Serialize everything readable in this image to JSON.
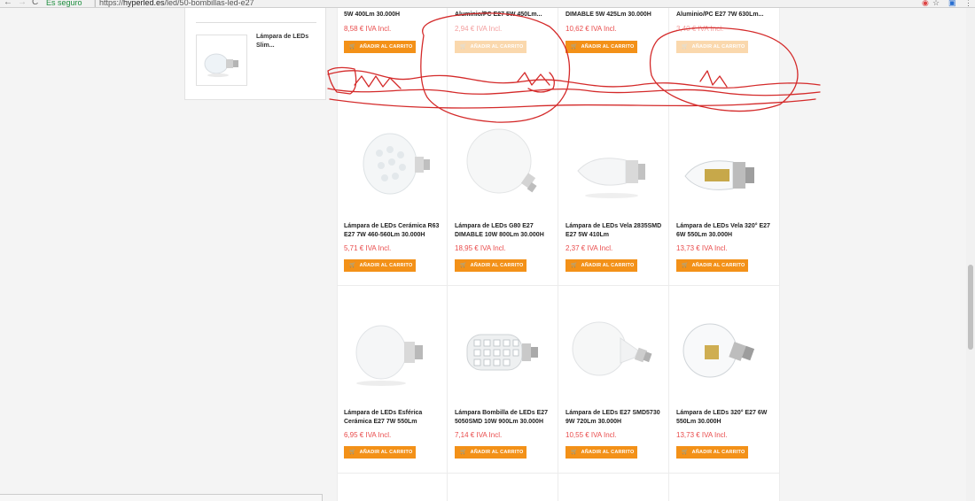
{
  "browser": {
    "nav_back": "←",
    "nav_forward": "→",
    "nav_reload": "C",
    "secure_label": "Es seguro",
    "separator": "|",
    "url_prefix": "https://",
    "url_domain": "hyperled.es",
    "url_path": "/led/50-bombillas-led-e27"
  },
  "sidebar": {
    "product_name": "Lámpara de LEDs Slim..."
  },
  "top_row": [
    {
      "title_tail": "5W 400Lm 30.000H",
      "price": "8,58 € IVA Incl.",
      "button": "AÑADIR AL CARRITO",
      "faded": false
    },
    {
      "title_tail": "Aluminio/PC E27 5W 450Lm...",
      "price": "2,94 € IVA Incl.",
      "button": "AÑADIR AL CARRITO",
      "faded": true
    },
    {
      "title_tail": "DIMABLE 5W 425Lm 30.000H",
      "price": "10,62 € IVA Incl.",
      "button": "AÑADIR AL CARRITO",
      "faded": false
    },
    {
      "title_tail": "Aluminio/PC E27 7W 630Lm...",
      "price": "3,40 € IVA Incl.",
      "button": "AÑADIR AL CARRITO",
      "faded": true
    }
  ],
  "row2": [
    {
      "title": "Lámpara de LEDs Cerámica R63 E27 7W 460-560Lm 30.000H",
      "price": "5,71 € IVA Incl.",
      "button": "AÑADIR AL CARRITO"
    },
    {
      "title": "Lámpara de LEDs G80 E27 DIMABLE 10W 800Lm 30.000H",
      "price": "18,95 € IVA Incl.",
      "button": "AÑADIR AL CARRITO"
    },
    {
      "title": "Lámpara de LEDs Vela 2835SMD E27 5W 410Lm",
      "price": "2,37 € IVA Incl.",
      "button": "AÑADIR AL CARRITO"
    },
    {
      "title": "Lámpara de LEDs Vela 320° E27 6W 550Lm 30.000H",
      "price": "13,73 € IVA Incl.",
      "button": "AÑADIR AL CARRITO"
    }
  ],
  "row3": [
    {
      "title": "Lámpara de LEDs Esférica Cerámica E27 7W 550Lm",
      "price": "6,95 € IVA Incl.",
      "button": "AÑADIR AL CARRITO"
    },
    {
      "title": "Lámpara Bombilla de LEDs E27 5050SMD 10W 900Lm 30.000H",
      "price": "7,14 € IVA Incl.",
      "button": "AÑADIR AL CARRITO"
    },
    {
      "title": "Lámpara de LEDs E27 SMD5730 9W 720Lm 30.000H",
      "price": "10,55 € IVA Incl.",
      "button": "AÑADIR AL CARRITO"
    },
    {
      "title": "Lámpara de LEDs 320° E27 6W 550Lm 30.000H",
      "price": "13,73 € IVA Incl.",
      "button": "AÑADIR AL CARRITO"
    }
  ],
  "colors": {
    "accent": "#f39118",
    "price": "#e94b4b",
    "annotation": "#d42a2a"
  }
}
